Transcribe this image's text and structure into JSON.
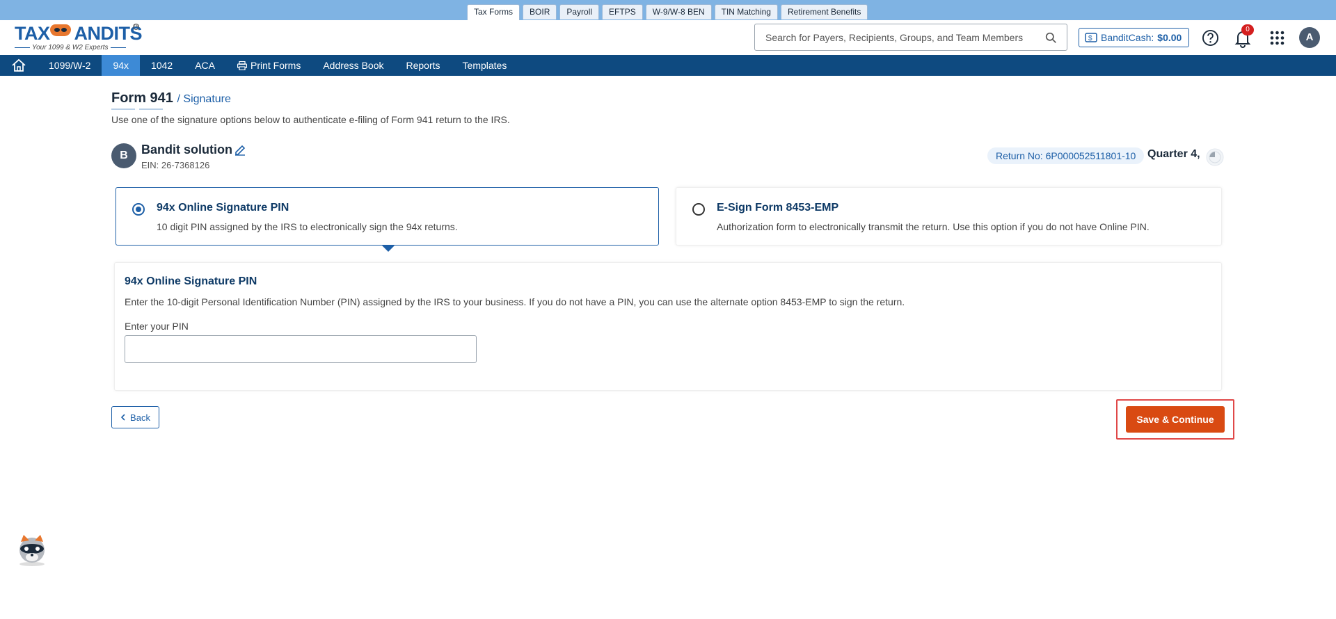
{
  "top_tabs": [
    "Tax Forms",
    "BOIR",
    "Payroll",
    "EFTPS",
    "W-9/W-8 BEN",
    "TIN Matching",
    "Retirement Benefits"
  ],
  "header": {
    "logo_text": "TAXBANDITS",
    "logo_tagline": "Your 1099 & W2 Experts",
    "search_placeholder": "Search for Payers, Recipients, Groups, and Team Members",
    "bandit_cash_label": "BanditCash:",
    "bandit_cash_amount": "$0.00",
    "notification_count": "0",
    "avatar_initial": "A"
  },
  "nav": {
    "items": [
      "1099/W-2",
      "94x",
      "1042",
      "ACA",
      "Print Forms",
      "Address Book",
      "Reports",
      "Templates"
    ],
    "active": "94x"
  },
  "page": {
    "title": "Form 941",
    "crumb": "/ Signature",
    "instruction": "Use one of the signature options below to authenticate e-filing of Form 941 return to the IRS."
  },
  "payer": {
    "initial": "B",
    "name": "Bandit solution",
    "ein": "EIN: 26-7368126",
    "return_no": "Return No: 6P000052511801-10",
    "quarter": "Quarter 4,"
  },
  "options": [
    {
      "title": "94x Online Signature PIN",
      "desc": "10 digit PIN assigned by the IRS to electronically sign the 94x returns.",
      "selected": true
    },
    {
      "title": "E-Sign Form 8453-EMP",
      "desc": "Authorization form to electronically transmit the return. Use this option if you do not have Online PIN.",
      "selected": false
    }
  ],
  "pin_section": {
    "title": "94x Online Signature PIN",
    "desc": "Enter the 10-digit Personal Identification Number (PIN) assigned by the IRS to your business. If you do not have a PIN, you can use the alternate option 8453-EMP to sign the return.",
    "label": "Enter your PIN",
    "value": ""
  },
  "buttons": {
    "back": "Back",
    "save": "Save & Continue"
  },
  "colors": {
    "brand_blue": "#1d5fa7",
    "nav_bg": "#0e4a80",
    "nav_active": "#3d8ad6",
    "save_btn": "#d94a12",
    "highlight": "#e04848"
  }
}
